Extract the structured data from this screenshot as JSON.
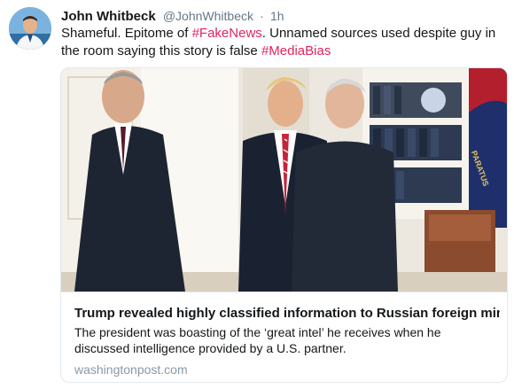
{
  "tweet": {
    "display_name": "John Whitbeck",
    "handle": "@JohnWhitbeck",
    "separator": "·",
    "time": "1h",
    "text_parts": {
      "t1": "Shameful. Epitome of ",
      "h1": "#FakeNews",
      "t2": ". Unnamed sources used despite guy in the room saying this story is false ",
      "h2": "#MediaBias"
    }
  },
  "card": {
    "title": "Trump revealed highly classified information to Russian foreign min...",
    "description": "The president was boasting of the ‘great intel’ he receives when he discussed intelligence provided by a U.S. partner.",
    "domain": "washingtonpost.com",
    "photo_flag_text": "PARATUS"
  },
  "colors": {
    "hashtag": "#e0245e",
    "secondary_text": "#657786",
    "card_border": "#e1e8ed",
    "domain_text": "#8899a6"
  }
}
